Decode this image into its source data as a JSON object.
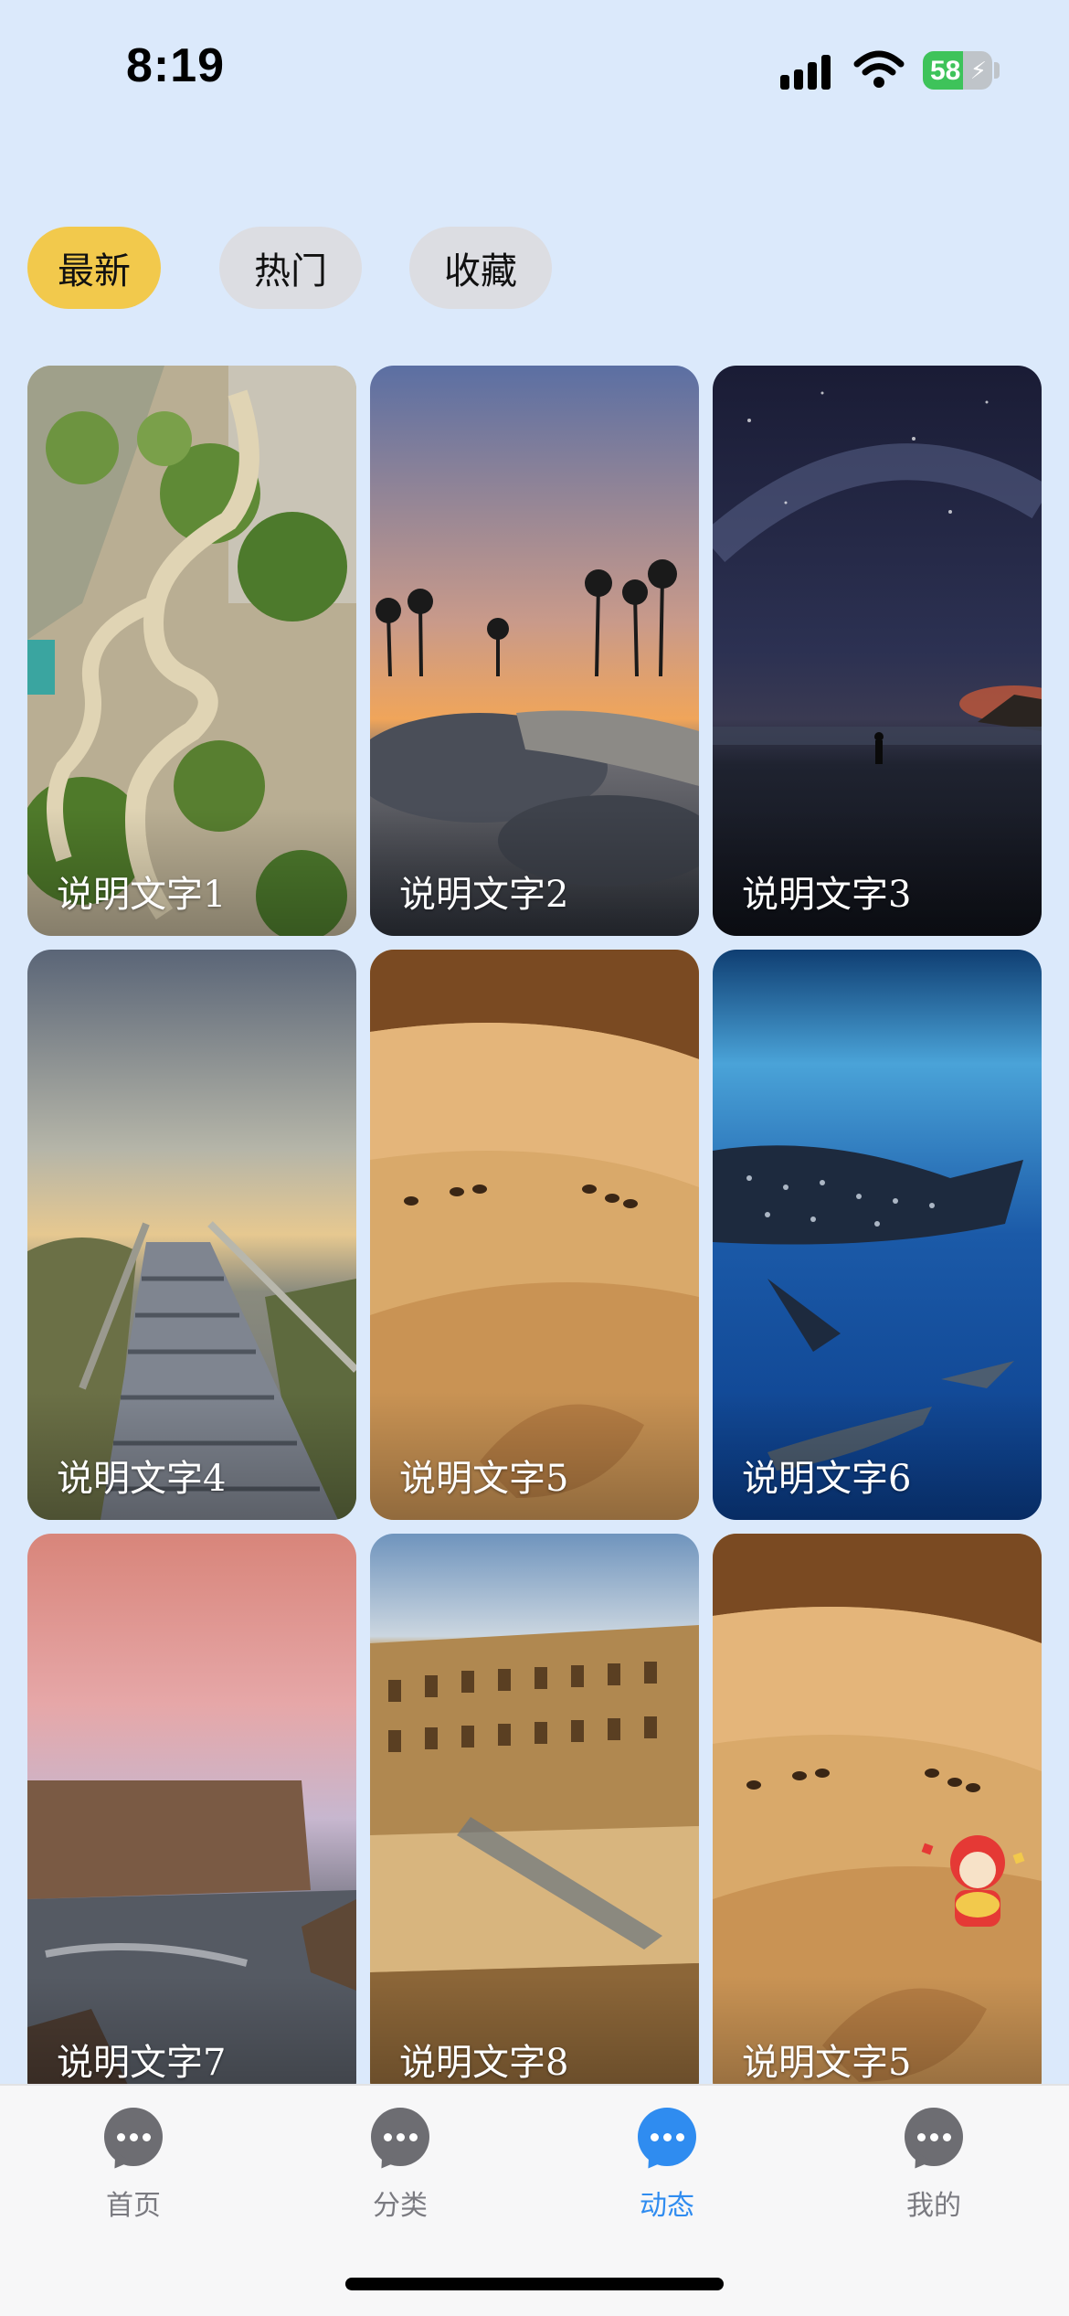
{
  "status_bar": {
    "time": "8:19",
    "battery_percent": "58",
    "battery_level": 0.58
  },
  "tabs": [
    {
      "label": "最新",
      "active": true
    },
    {
      "label": "热门",
      "active": false
    },
    {
      "label": "收藏",
      "active": false
    }
  ],
  "cards": [
    {
      "caption": "说明文字1",
      "scene": "cliff-road"
    },
    {
      "caption": "说明文字2",
      "scene": "skatepark-sunset"
    },
    {
      "caption": "说明文字3",
      "scene": "night-beach"
    },
    {
      "caption": "说明文字4",
      "scene": "boardwalk-stairs"
    },
    {
      "caption": "说明文字5",
      "scene": "desert-camels"
    },
    {
      "caption": "说明文字6",
      "scene": "whale-shark"
    },
    {
      "caption": "说明文字7",
      "scene": "sea-cliffs-pink-sky"
    },
    {
      "caption": "说明文字8",
      "scene": "colosseum-ruins"
    },
    {
      "caption": "说明文字5",
      "scene": "desert-camels"
    }
  ],
  "bottom_nav": [
    {
      "label": "首页",
      "icon": "chat-bubble-icon",
      "active": false
    },
    {
      "label": "分类",
      "icon": "chat-bubble-icon",
      "active": false
    },
    {
      "label": "动态",
      "icon": "chat-bubble-icon",
      "active": true
    },
    {
      "label": "我的",
      "icon": "chat-bubble-icon",
      "active": false
    }
  ],
  "colors": {
    "background": "#dbe9fb",
    "active_tab": "#f2c94c",
    "inactive_tab": "#dcdde2",
    "nav_active": "#2f8cf0",
    "nav_inactive": "#6d6d72"
  }
}
